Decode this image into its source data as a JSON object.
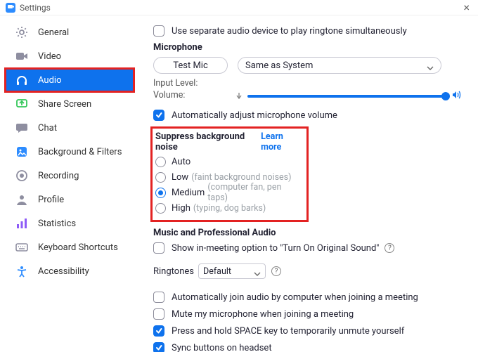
{
  "titlebar": {
    "title": "Settings"
  },
  "sidebar": {
    "items": [
      {
        "label": "General",
        "icon": "gear"
      },
      {
        "label": "Video",
        "icon": "video"
      },
      {
        "label": "Audio",
        "icon": "headphones",
        "active": true,
        "highlighted": true
      },
      {
        "label": "Share Screen",
        "icon": "share"
      },
      {
        "label": "Chat",
        "icon": "chat"
      },
      {
        "label": "Background & Filters",
        "icon": "background"
      },
      {
        "label": "Recording",
        "icon": "record"
      },
      {
        "label": "Profile",
        "icon": "profile"
      },
      {
        "label": "Statistics",
        "icon": "stats"
      },
      {
        "label": "Keyboard Shortcuts",
        "icon": "keyboard"
      },
      {
        "label": "Accessibility",
        "icon": "accessibility"
      }
    ]
  },
  "main": {
    "separate_device": {
      "label": "Use separate audio device to play ringtone simultaneously",
      "checked": false
    },
    "microphone": {
      "title": "Microphone",
      "test_label": "Test Mic",
      "device_label": "Same as System",
      "input_level_label": "Input Level:",
      "volume_label": "Volume:"
    },
    "auto_adjust": {
      "label": "Automatically adjust microphone volume",
      "checked": true
    },
    "noise": {
      "title": "Suppress background noise",
      "learn_more": "Learn more",
      "options": [
        {
          "label": "Auto",
          "hint": "",
          "selected": false
        },
        {
          "label": "Low",
          "hint": "(faint background noises)",
          "selected": false
        },
        {
          "label": "Medium",
          "hint": "(computer fan, pen taps)",
          "selected": true
        },
        {
          "label": "High",
          "hint": "(typing, dog barks)",
          "selected": false
        }
      ]
    },
    "music": {
      "title": "Music and Professional Audio",
      "option_label": "Show in-meeting option to \"Turn On Original Sound\"",
      "checked": false
    },
    "ringtones": {
      "label": "Ringtones",
      "value": "Default"
    },
    "auto_join": {
      "label": "Automatically join audio by computer when joining a meeting",
      "checked": false
    },
    "mute_on_join": {
      "label": "Mute my microphone when joining a meeting",
      "checked": false
    },
    "space_unmute": {
      "label": "Press and hold SPACE key to temporarily unmute yourself",
      "checked": true
    },
    "sync_headset": {
      "label": "Sync buttons on headset",
      "checked": true
    }
  },
  "colors": {
    "accent": "#0E72ED",
    "highlight": "#E32222"
  }
}
